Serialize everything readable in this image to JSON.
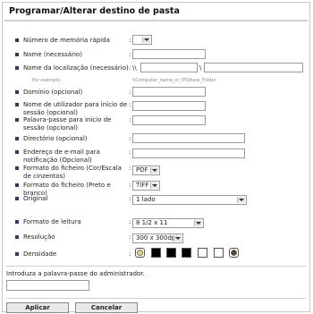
{
  "title": "Programar/Alterar destino de pasta",
  "fields": {
    "quick_memory": "Número de memória rápida",
    "name": "Nome (necessário)",
    "location": "Nome da localização (necessário)",
    "location_prefix": "\\\\",
    "location_sep": "\\",
    "example_label": "Por exemplo:",
    "example_value": "\\\\Computer_name_or_IP\\Share_Folder",
    "domain": "Domínio (opcional)",
    "username": "Nome de utilizador para início de sessão (opcional)",
    "password": "Palavra-passe para início de sessão (opcional)",
    "directory": "Directório (opcional)",
    "email": "Endereço de e-mail para notificação (Opcional)",
    "file_format_color": "Formato do ficheiro (Cor/Escala de cinzentos)",
    "file_format_color_value": "PDF",
    "file_format_bw": "Formato do ficheiro (Preto e branco)",
    "file_format_bw_value": "TIFF",
    "original": "Original",
    "original_value": "1 lado",
    "scan_size": "Formato de leitura",
    "scan_size_value": "8 1/2 x 11",
    "resolution": "Resolução",
    "resolution_value": "300 x 300dpi",
    "density": "Densidade",
    "colon": ":"
  },
  "admin_prompt": "Introduza a palavra-passe do administrador.",
  "buttons": {
    "apply": "Aplicar",
    "cancel": "Cancelar"
  },
  "colors": {
    "bullet": "#1c3c8c",
    "swatch_dark": "#000000",
    "swatch_light": "#ffffff"
  }
}
